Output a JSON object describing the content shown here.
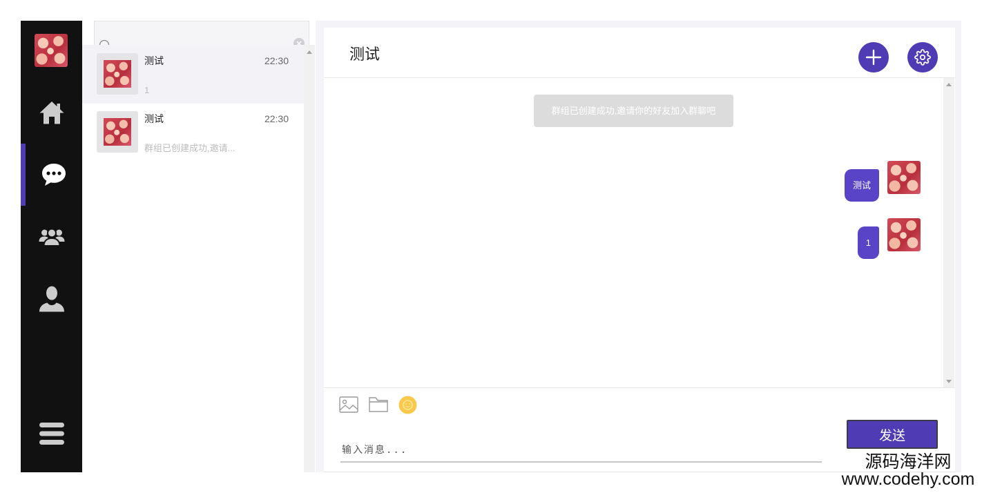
{
  "colors": {
    "accent": "#4f3bb4",
    "bubble": "#5944c8",
    "sidebar_bg": "#111111",
    "active_item_bg": "#f3f3f7",
    "system_msg_bg": "#dcdcdc",
    "emoji": "#f8c94a"
  },
  "sidebar": {
    "items": [
      {
        "icon": "home-icon",
        "active": false
      },
      {
        "icon": "chat-icon",
        "active": true
      },
      {
        "icon": "group-icon",
        "active": false
      },
      {
        "icon": "user-icon",
        "active": false
      }
    ],
    "menu_icon": "menu-icon"
  },
  "search": {
    "icon": "search-icon",
    "clear_icon": "clear-icon"
  },
  "conversations": [
    {
      "name": "测试",
      "time": "22:30",
      "preview": "1",
      "active": true
    },
    {
      "name": "测试",
      "time": "22:30",
      "preview": "群组已创建成功,邀请...",
      "active": false
    }
  ],
  "chat": {
    "title": "测试",
    "header_buttons": [
      {
        "icon": "plus-icon"
      },
      {
        "icon": "gear-icon"
      }
    ],
    "system_message": "群组已创建成功,邀请你的好友加入群聊吧",
    "messages": [
      {
        "text": "测试",
        "outgoing": true
      },
      {
        "text": "1",
        "outgoing": true
      }
    ],
    "toolbar": [
      {
        "icon": "image-icon"
      },
      {
        "icon": "folder-icon"
      },
      {
        "icon": "emoji-icon"
      }
    ],
    "input": {
      "placeholder": "输入消息..."
    },
    "send_label": "发送"
  },
  "watermark": {
    "line1": "源码海洋网",
    "line2": "www.codehy.com"
  }
}
